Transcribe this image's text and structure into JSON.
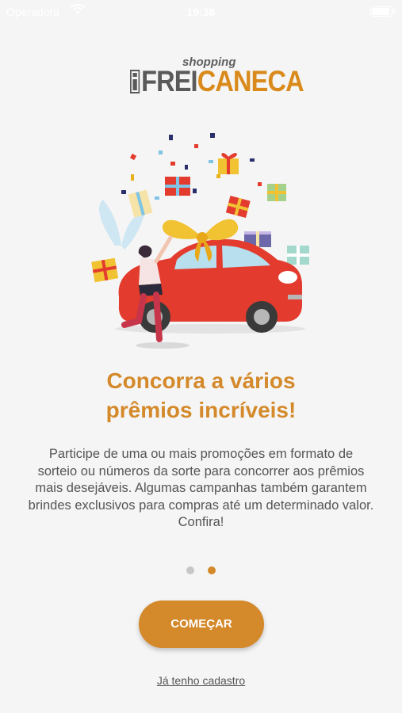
{
  "status_bar": {
    "carrier": "Operadora",
    "time": "19:38",
    "icons": [
      "wifi-icon",
      "battery-icon"
    ]
  },
  "logo": {
    "small": "shopping",
    "main_part1": "FREI",
    "main_part2": "CANECA"
  },
  "illustration": {
    "description_icon": "car-gift-illustration"
  },
  "onboarding": {
    "headline_line1": "Concorra a vários",
    "headline_line2": "prêmios incríveis!",
    "body": "Participe de uma ou mais promoções em formato de sorteio ou números da sorte para concorrer aos prêmios mais desejáveis. Algumas campanhas também garantem brindes exclusivos para compras até um determinado valor. Confira!",
    "pages_total": 2,
    "current_page": 2
  },
  "actions": {
    "start_label": "COMEÇAR",
    "login_label": "Já tenho cadastro"
  },
  "colors": {
    "accent": "#d4892a",
    "background": "#f5f5f5",
    "car": "#e33b2e",
    "text": "#555555"
  }
}
